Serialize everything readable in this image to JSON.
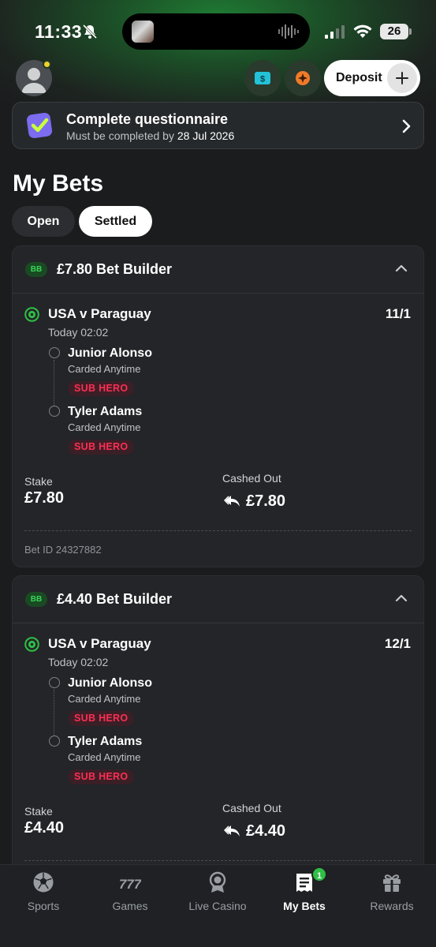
{
  "status_bar": {
    "time": "11:33",
    "battery": "26"
  },
  "header": {
    "deposit_label": "Deposit"
  },
  "questionnaire": {
    "title": "Complete questionnaire",
    "subtitle_prefix": "Must be completed by",
    "deadline": "28 Jul 2026"
  },
  "page": {
    "title": "My Bets",
    "tabs": [
      {
        "label": "Open",
        "active": false
      },
      {
        "label": "Settled",
        "active": true
      }
    ]
  },
  "bets": [
    {
      "badge": "BB",
      "title": "£7.80 Bet Builder",
      "match": "USA v Paraguay",
      "time": "Today 02:02",
      "odds": "11/1",
      "selections": [
        {
          "name": "Junior Alonso",
          "market": "Carded Anytime",
          "tag": "SUB HERO"
        },
        {
          "name": "Tyler Adams",
          "market": "Carded Anytime",
          "tag": "SUB HERO"
        }
      ],
      "stake_label": "Stake",
      "stake": "£7.80",
      "cashed_label": "Cashed Out",
      "cashed": "£7.80",
      "bet_id": "Bet ID 24327882"
    },
    {
      "badge": "BB",
      "title": "£4.40 Bet Builder",
      "match": "USA v Paraguay",
      "time": "Today 02:02",
      "odds": "12/1",
      "selections": [
        {
          "name": "Junior Alonso",
          "market": "Carded Anytime",
          "tag": "SUB HERO"
        },
        {
          "name": "Tyler Adams",
          "market": "Carded Anytime",
          "tag": "SUB HERO"
        }
      ],
      "stake_label": "Stake",
      "stake": "£4.40",
      "cashed_label": "Cashed Out",
      "cashed": "£4.40"
    }
  ],
  "tab_bar": {
    "items": [
      {
        "label": "Sports",
        "icon": "soccer-ball-icon"
      },
      {
        "label": "Games",
        "icon": "777-icon"
      },
      {
        "label": "Live Casino",
        "icon": "medal-icon"
      },
      {
        "label": "My Bets",
        "icon": "bet-slip-icon",
        "badge": "1",
        "active": true
      },
      {
        "label": "Rewards",
        "icon": "gift-icon"
      }
    ]
  },
  "colors": {
    "brand_green": "#2fbf46",
    "sub_hero_red": "#ff2e54",
    "background": "#1b1c1e",
    "card": "#232528"
  }
}
